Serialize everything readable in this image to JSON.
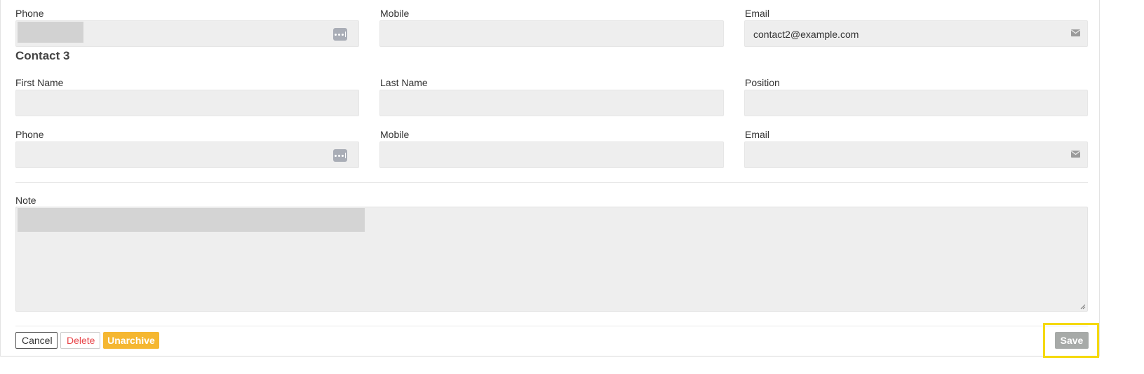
{
  "contact2": {
    "phone_label": "Phone",
    "phone_value": "",
    "mobile_label": "Mobile",
    "email_label": "Email",
    "email_value": "contact2@example.com"
  },
  "contact3": {
    "title": "Contact 3",
    "first_name_label": "First Name",
    "last_name_label": "Last Name",
    "position_label": "Position",
    "phone_label": "Phone",
    "mobile_label": "Mobile",
    "email_label": "Email"
  },
  "note": {
    "label": "Note",
    "value": ""
  },
  "buttons": {
    "cancel": "Cancel",
    "delete": "Delete",
    "unarchive": "Unarchive",
    "save": "Save"
  },
  "colors": {
    "unarchive_bg": "#f5b731",
    "delete_text": "#e8464a",
    "save_bg": "#a7aaa8",
    "highlight": "#f5d90a"
  },
  "icons": {
    "phone_action": "more-dots-icon",
    "email": "envelope-icon"
  }
}
